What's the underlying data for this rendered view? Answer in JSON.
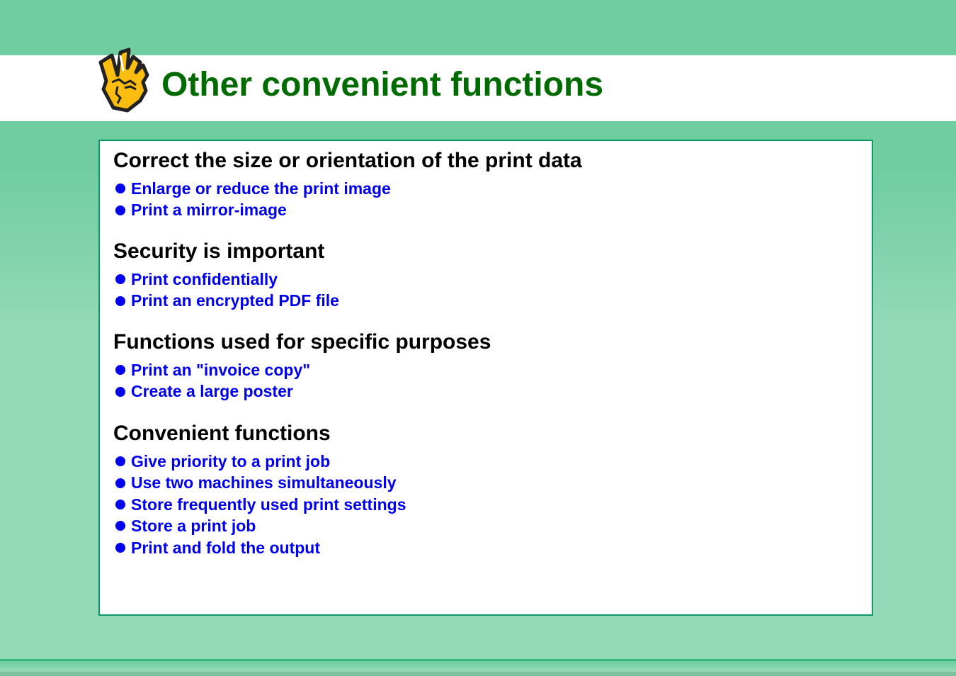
{
  "header": {
    "title": "Other convenient functions",
    "icon": "hand-victory-icon"
  },
  "sections": [
    {
      "heading": "Correct the size or orientation of the print data",
      "links": [
        "Enlarge or reduce the print image",
        "Print a mirror-image"
      ]
    },
    {
      "heading": "Security is important",
      "links": [
        "Print confidentially",
        "Print an encrypted PDF file"
      ]
    },
    {
      "heading": "Functions used for specific purposes",
      "links": [
        "Print an \"invoice copy\"",
        "Create a large poster"
      ]
    },
    {
      "heading": "Convenient functions",
      "links": [
        "Give priority to a print job",
        "Use two machines simultaneously",
        "Store frequently used print settings",
        "Store a print job",
        "Print and fold the output"
      ]
    }
  ],
  "colors": {
    "title": "#006b00",
    "link": "#0000ee",
    "border": "#0c9a68",
    "background_top": "#70cda2",
    "background_bottom": "#93d9b8"
  }
}
